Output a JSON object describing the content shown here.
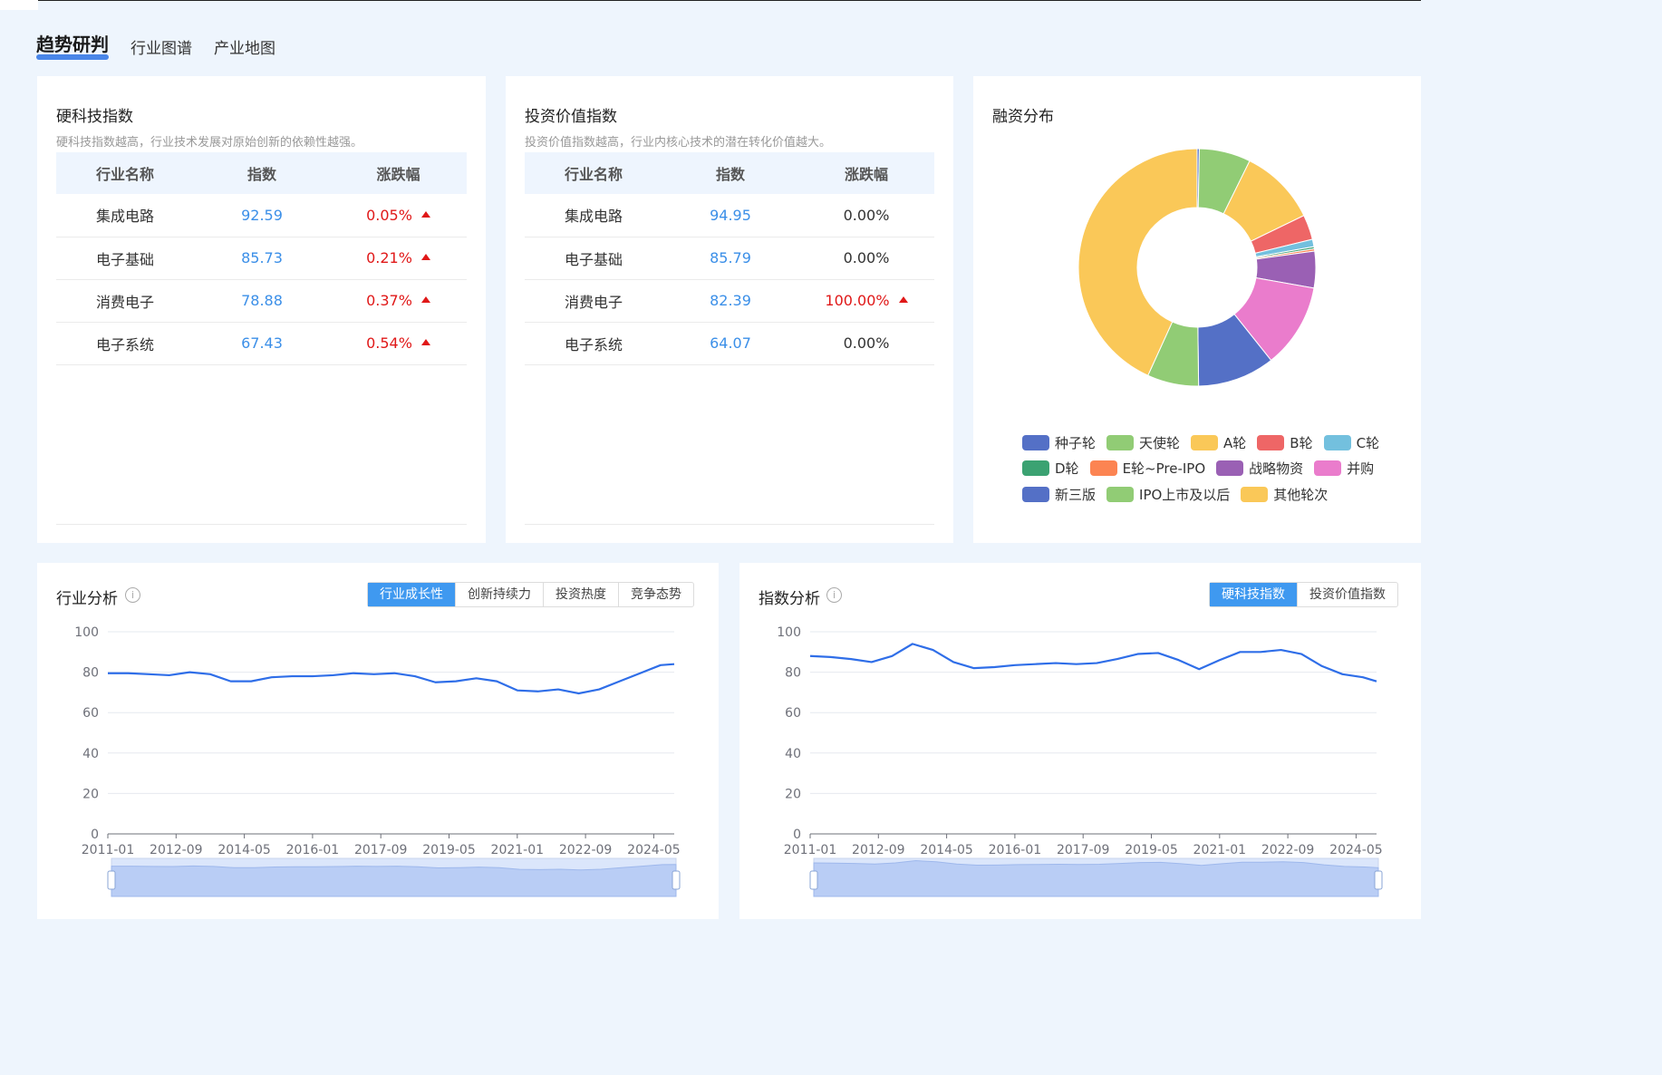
{
  "tabs": [
    {
      "label": "趋势研判",
      "active": true
    },
    {
      "label": "行业图谱",
      "active": false
    },
    {
      "label": "产业地图",
      "active": false
    }
  ],
  "hard_tech": {
    "title": "硬科技指数",
    "subtitle": "硬科技指数越高，行业技术发展对原始创新的依赖性越强。",
    "headers": [
      "行业名称",
      "指数",
      "涨跌幅"
    ],
    "rows": [
      {
        "name": "集成电路",
        "index": "92.59",
        "change": "0.05%",
        "up": true
      },
      {
        "name": "电子基础",
        "index": "85.73",
        "change": "0.21%",
        "up": true
      },
      {
        "name": "消费电子",
        "index": "78.88",
        "change": "0.37%",
        "up": true
      },
      {
        "name": "电子系统",
        "index": "67.43",
        "change": "0.54%",
        "up": true
      }
    ]
  },
  "invest_value": {
    "title": "投资价值指数",
    "subtitle": "投资价值指数越高，行业内核心技术的潜在转化价值越大。",
    "headers": [
      "行业名称",
      "指数",
      "涨跌幅"
    ],
    "rows": [
      {
        "name": "集成电路",
        "index": "94.95",
        "change": "0.00%",
        "up": false
      },
      {
        "name": "电子基础",
        "index": "85.79",
        "change": "0.00%",
        "up": false
      },
      {
        "name": "消费电子",
        "index": "82.39",
        "change": "100.00%",
        "up": true
      },
      {
        "name": "电子系统",
        "index": "64.07",
        "change": "0.00%",
        "up": false
      }
    ]
  },
  "financing": {
    "title": "融资分布",
    "legend_rows": [
      [
        {
          "label": "种子轮",
          "color": "#5470c6"
        },
        {
          "label": "天使轮",
          "color": "#91cc75"
        },
        {
          "label": "A轮",
          "color": "#fac858"
        },
        {
          "label": "B轮",
          "color": "#ee6666"
        },
        {
          "label": "C轮",
          "color": "#73c0de"
        }
      ],
      [
        {
          "label": "D轮",
          "color": "#3ba272"
        },
        {
          "label": "E轮~Pre-IPO",
          "color": "#fc8452"
        },
        {
          "label": "战略物资",
          "color": "#9a60b4"
        },
        {
          "label": "并购",
          "color": "#ea7ccc"
        }
      ],
      [
        {
          "label": "新三版",
          "color": "#5470c6"
        },
        {
          "label": "IPO上市及以后",
          "color": "#91cc75"
        },
        {
          "label": "其他轮次",
          "color": "#fac858"
        }
      ]
    ]
  },
  "industry_analysis": {
    "title": "行业分析",
    "info_icon": "info-icon",
    "buttons": [
      {
        "label": "行业成长性",
        "active": true
      },
      {
        "label": "创新持续力",
        "active": false
      },
      {
        "label": "投资热度",
        "active": false
      },
      {
        "label": "竞争态势",
        "active": false
      }
    ]
  },
  "index_analysis": {
    "title": "指数分析",
    "info_icon": "info-icon",
    "buttons": [
      {
        "label": "硬科技指数",
        "active": true
      },
      {
        "label": "投资价值指数",
        "active": false
      }
    ]
  },
  "chart_data": [
    {
      "type": "pie",
      "title": "融资分布",
      "donut": true,
      "color_by_category": {
        "种子轮": "#5470c6",
        "天使轮": "#91cc75",
        "A轮": "#fac858",
        "B轮": "#ee6666",
        "C轮": "#73c0de",
        "D轮": "#3ba272",
        "E轮~Pre-IPO": "#fc8452",
        "战略物资": "#9a60b4",
        "并购": "#ea7ccc",
        "新三版": "#5470c6",
        "IPO上市及以后": "#91cc75",
        "其他轮次": "#fac858"
      },
      "categories": [
        "种子轮",
        "天使轮",
        "A轮",
        "B轮",
        "C轮",
        "D轮",
        "E轮~Pre-IPO",
        "战略物资",
        "并购",
        "新三版",
        "IPO上市及以后",
        "其他轮次"
      ],
      "values": [
        0.3,
        7.0,
        10.5,
        3.4,
        1.0,
        0.3,
        0.3,
        5.0,
        11.5,
        10.5,
        7.0,
        43.2
      ]
    },
    {
      "type": "line",
      "panel": "行业分析",
      "series_color": "#2f6ee8",
      "ylim": [
        0,
        100
      ],
      "yticks": [
        0,
        20,
        40,
        60,
        80,
        100
      ],
      "xticks": [
        "2011-01",
        "2012-09",
        "2014-05",
        "2016-01",
        "2017-09",
        "2019-05",
        "2021-01",
        "2022-09",
        "2024-05"
      ],
      "x": [
        "2011-01",
        "2011-07",
        "2012-01",
        "2012-07",
        "2013-01",
        "2013-07",
        "2014-01",
        "2014-07",
        "2015-01",
        "2015-07",
        "2016-01",
        "2016-07",
        "2017-01",
        "2017-07",
        "2018-01",
        "2018-07",
        "2019-01",
        "2019-07",
        "2020-01",
        "2020-07",
        "2021-01",
        "2021-07",
        "2022-01",
        "2022-07",
        "2023-01",
        "2023-07",
        "2024-01",
        "2024-07",
        "2024-11"
      ],
      "series": [
        {
          "values": [
            79.5,
            79.5,
            79,
            78.5,
            80,
            79,
            75.5,
            75.5,
            77.5,
            78,
            78,
            78.5,
            79.5,
            79,
            79.5,
            78,
            75,
            75.5,
            77,
            75.5,
            71,
            70.5,
            71.5,
            69.5,
            71.5,
            75.5,
            79.5,
            83.5,
            84
          ]
        }
      ]
    },
    {
      "type": "line",
      "panel": "指数分析",
      "series_color": "#2f6ee8",
      "ylim": [
        0,
        100
      ],
      "yticks": [
        0,
        20,
        40,
        60,
        80,
        100
      ],
      "xticks": [
        "2011-01",
        "2012-09",
        "2014-05",
        "2016-01",
        "2017-09",
        "2019-05",
        "2021-01",
        "2022-09",
        "2024-05"
      ],
      "x": [
        "2011-01",
        "2011-07",
        "2012-01",
        "2012-07",
        "2013-01",
        "2013-07",
        "2014-01",
        "2014-07",
        "2015-01",
        "2015-07",
        "2016-01",
        "2016-07",
        "2017-01",
        "2017-07",
        "2018-01",
        "2018-07",
        "2019-01",
        "2019-07",
        "2020-01",
        "2020-07",
        "2021-01",
        "2021-07",
        "2022-01",
        "2022-07",
        "2023-01",
        "2023-07",
        "2024-01",
        "2024-07",
        "2024-11"
      ],
      "series": [
        {
          "values": [
            88,
            87.5,
            86.5,
            85,
            88,
            94,
            91,
            85,
            82,
            82.5,
            83.5,
            84,
            84.5,
            84,
            84.5,
            86.5,
            89,
            89.5,
            86,
            81.5,
            86,
            90,
            90,
            91,
            89,
            83,
            79,
            77.5,
            75.5
          ]
        }
      ]
    }
  ]
}
